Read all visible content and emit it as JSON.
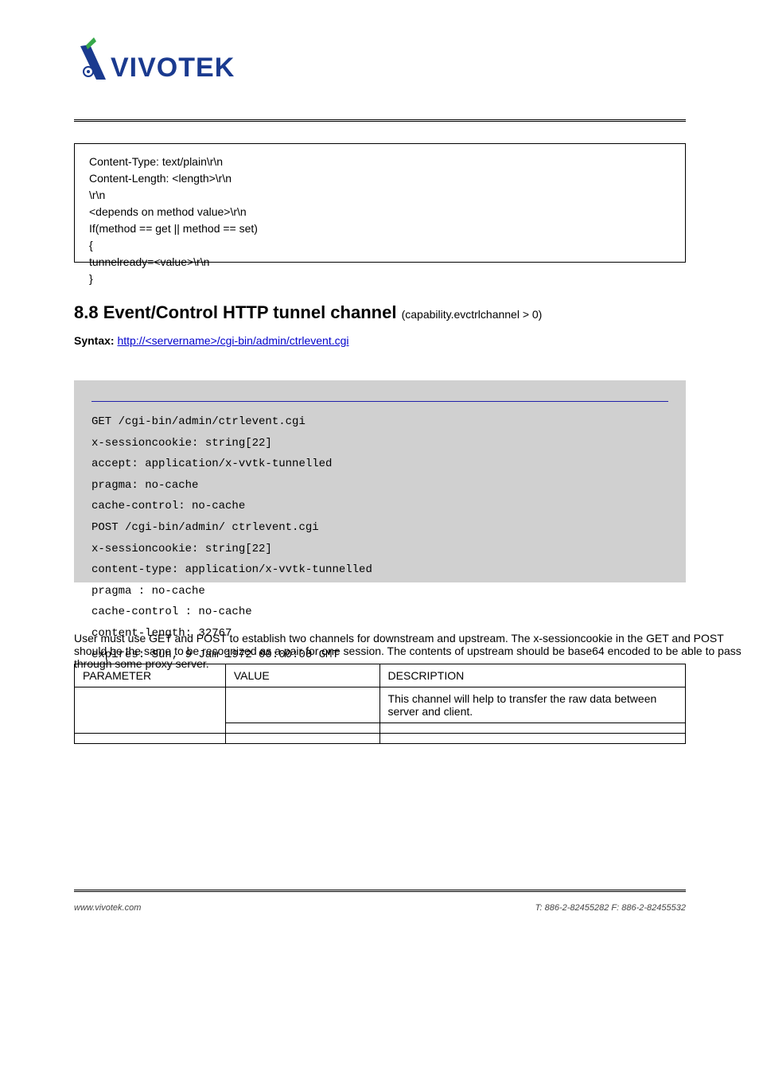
{
  "logo": {
    "brand": "VIVOTEK"
  },
  "box1": {
    "line1": "Content-Type: text/plain\\r\\n",
    "line2": "Content-Length: <length>\\r\\n",
    "line3": "\\r\\n",
    "line4": "<depends on method value>\\r\\n",
    "line5": "If(method == get || method == set)",
    "line6": "{",
    "line7": "tunnelready=<value>\\r\\n",
    "line8": "}"
  },
  "section": {
    "number": "8.8",
    "title": "Event/Control HTTP tunnel channel",
    "note": "(capability.evctrlchannel > 0)",
    "syntax_label": "Syntax:"
  },
  "url": "http://<servername>/cgi-bin/admin/ctrlevent.cgi",
  "graybox": {
    "line_hdr": "-------------------------------------------------------------------------",
    "line1": "GET /cgi-bin/admin/ctrlevent.cgi",
    "line2": "x-sessioncookie: string[22]",
    "line3": "accept: application/x-vvtk-tunnelled",
    "line4": "pragma: no-cache",
    "line5": "cache-control: no-cache",
    "line_sep": "-------------------------------------------------------------------------",
    "line6": "POST /cgi-bin/admin/ ctrlevent.cgi",
    "line7": "x-sessioncookie: string[22]",
    "line8": "content-type: application/x-vvtk-tunnelled",
    "line9": "pragma : no-cache",
    "line10": "cache-control : no-cache",
    "line11": "content-length: 32767",
    "line12": "expires: Sun, 9 Jam 1972 00:00:00 GMT"
  },
  "params_label": "User must use GET and POST to establish two channels for downstream and upstream. The x-sessioncookie in the GET and POST should be the same to be recognized as a pair for one session. The contents of upstream should be base64 encoded to be able to pass through some proxy server.",
  "table": {
    "h1": "PARAMETER",
    "h2": "VALUE",
    "h3": "DESCRIPTION",
    "r1c1": "",
    "r1c2": "",
    "r1c3": "This channel will help to transfer the raw data between server and client.",
    "r2c1": "",
    "r2c2": "",
    "r2c3": "",
    "r3c1": "",
    "r3c2": "",
    "r3c3": ""
  },
  "footer": {
    "left": "www.vivotek.com",
    "right": "T: 886-2-82455282    F: 886-2-82455532"
  }
}
